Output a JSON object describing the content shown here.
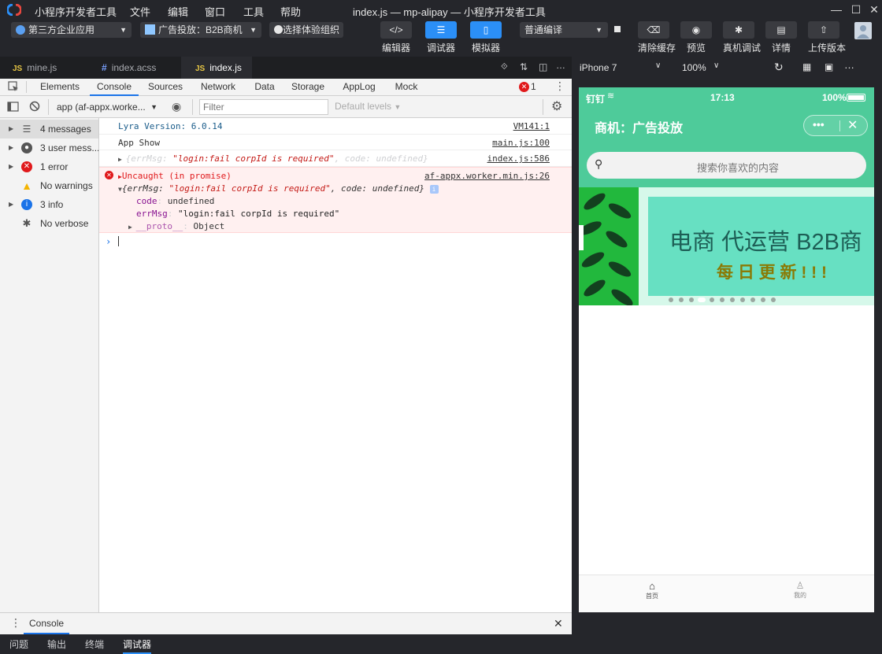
{
  "titlebar": {
    "menus": [
      "小程序开发者工具",
      "文件",
      "编辑",
      "窗口",
      "工具",
      "帮助"
    ],
    "title": "index.js — mp-alipay — 小程序开发者工具"
  },
  "toolbar": {
    "org_select": "第三方企业应用",
    "project_select": "广告投放：B2B商机",
    "experience_org": "选择体验组织",
    "tools": [
      {
        "label": "编辑器",
        "icon": "code-icon"
      },
      {
        "label": "调试器",
        "icon": "sliders-icon"
      },
      {
        "label": "模拟器",
        "icon": "phone-icon"
      }
    ],
    "compile_mode": "普通编译",
    "actions": [
      {
        "label": "清除缓存",
        "icon": "eraser-icon"
      },
      {
        "label": "预览",
        "icon": "preview-icon"
      },
      {
        "label": "真机调试",
        "icon": "bug-icon"
      },
      {
        "label": "详情",
        "icon": "doc-icon"
      },
      {
        "label": "上传版本",
        "icon": "upload-icon"
      }
    ]
  },
  "file_tabs": [
    {
      "name": "mine.js",
      "type": "JS"
    },
    {
      "name": "index.acss",
      "type": "#"
    },
    {
      "name": "index.js",
      "type": "JS"
    }
  ],
  "devtools": {
    "tabs": [
      "Elements",
      "Console",
      "Sources",
      "Network",
      "Data",
      "Storage",
      "AppLog",
      "Mock"
    ],
    "error_count": "1",
    "context": "app (af-appx.worke...",
    "filter_placeholder": "Filter",
    "levels": "Default levels",
    "sidebar": [
      {
        "label": "4 messages",
        "icon": "list-icon",
        "color": "#555555"
      },
      {
        "label": "3 user mess...",
        "icon": "user-icon",
        "color": "#555555"
      },
      {
        "label": "1 error",
        "icon": "error-icon",
        "color": "#e0191b"
      },
      {
        "label": "No warnings",
        "icon": "warning-icon",
        "color": "#f4b400"
      },
      {
        "label": "3 info",
        "icon": "info-icon",
        "color": "#1a73e8"
      },
      {
        "label": "No verbose",
        "icon": "bug-icon",
        "color": "#555555"
      }
    ],
    "console": {
      "lyra": {
        "text": "Lyra Version: 6.0.14",
        "src": "VM141:1"
      },
      "appshow": {
        "text": "App Show",
        "src": "main.js:100"
      },
      "obj": {
        "prefix": "{errMsg: ",
        "str": "\"login:fail corpId is required\"",
        "suffix": ", code: undefined}",
        "src": "index.js:586"
      },
      "error": {
        "title": "Uncaught (in promise)",
        "src": "af-appx.worker.min.js:26",
        "obj_prefix": "{errMsg: ",
        "obj_str": "\"login:fail corpId is required\"",
        "obj_suffix": ", code: undefined}",
        "code_key": "code",
        "code_val": "undefined",
        "errmsg_key": "errMsg",
        "errmsg_val": "\"login:fail corpId is required\"",
        "proto_key": "__proto__",
        "proto_val": "Object"
      }
    },
    "drawer_tab": "Console"
  },
  "bottom_tabs": [
    "问题",
    "输出",
    "终端",
    "调试器"
  ],
  "simulator": {
    "device": "iPhone 7",
    "zoom": "100%",
    "status": {
      "carrier": "钉钉",
      "time": "17:13",
      "battery": "100%"
    },
    "nav_title": "商机：广告投放",
    "search_placeholder": "搜索你喜欢的内容",
    "banner_title": "电商 代运营 B2B商",
    "banner_sub": "每 日 更 新 ! ! !",
    "tabs": [
      "首页",
      "我的"
    ]
  }
}
